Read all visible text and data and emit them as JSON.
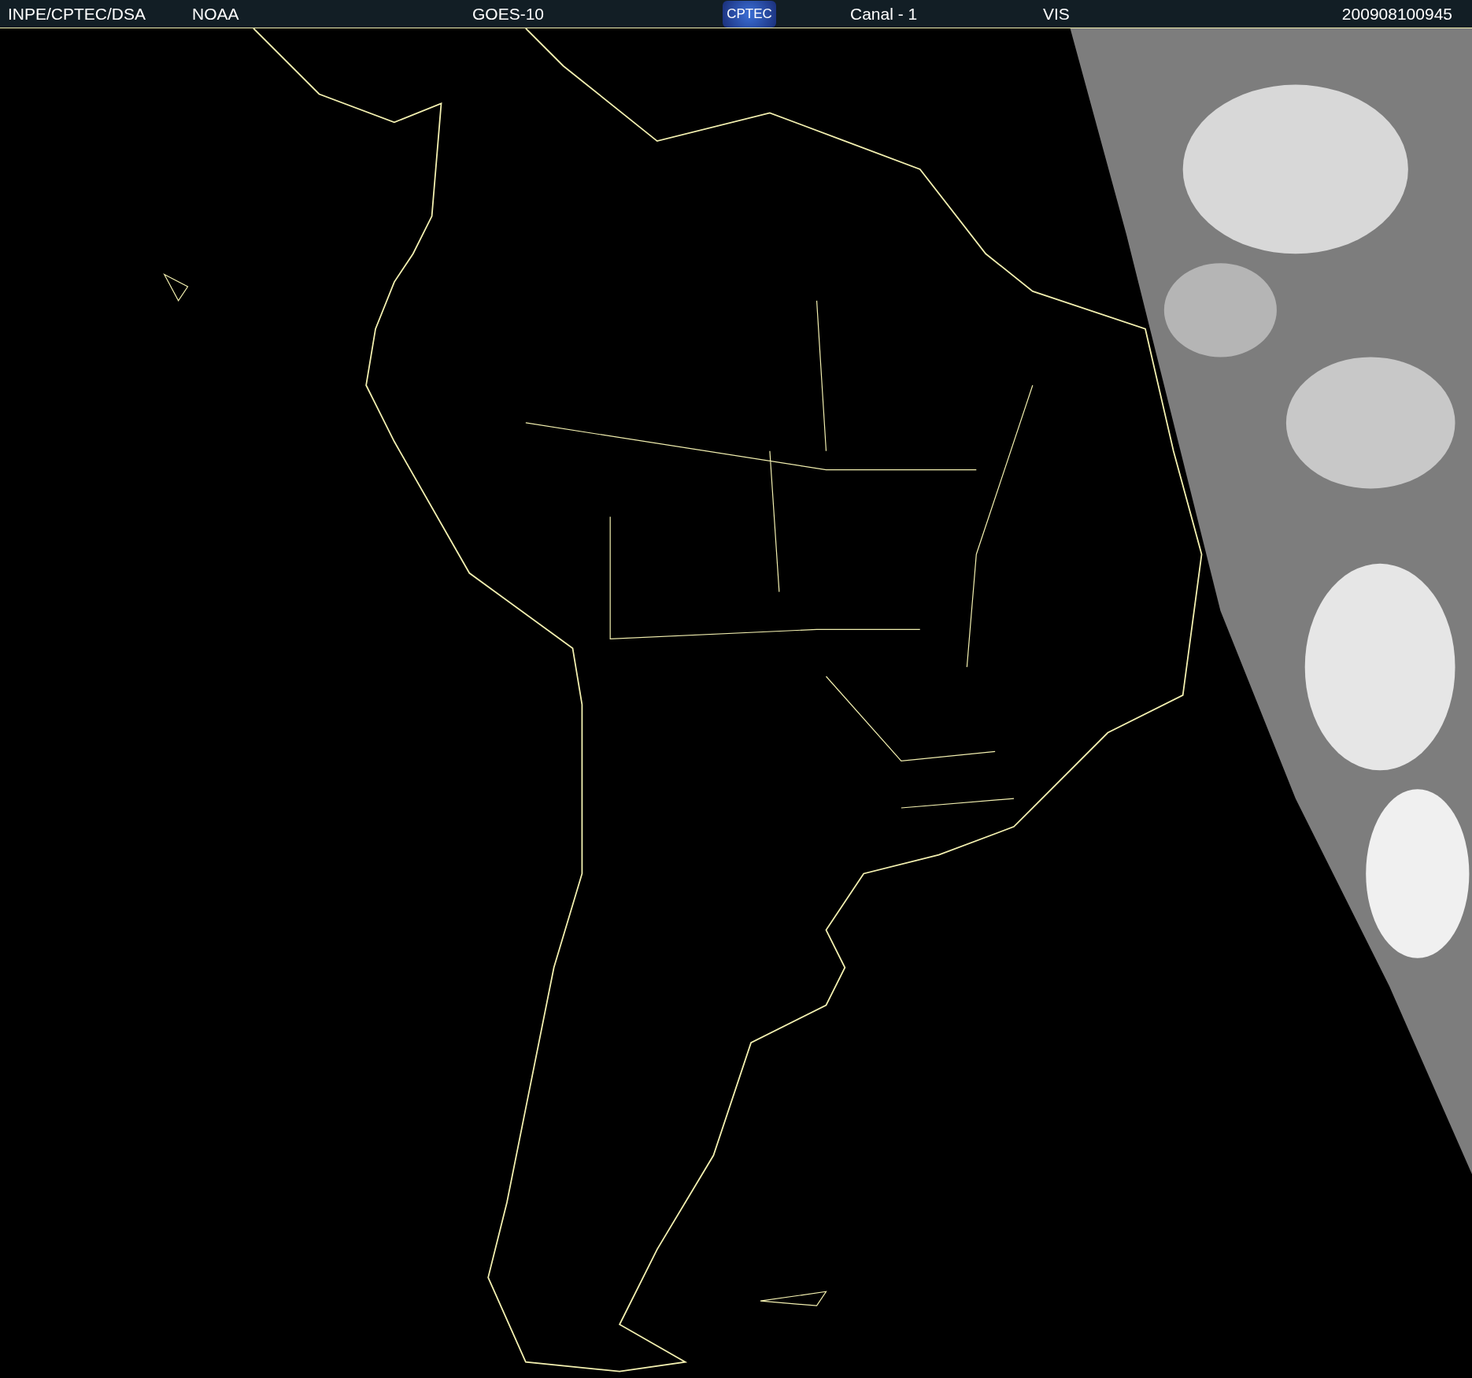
{
  "header": {
    "source": "INPE/CPTEC/DSA",
    "agency": "NOAA",
    "satellite": "GOES-10",
    "logo_text": "CPTEC",
    "channel": "Canal - 1",
    "band": "VIS",
    "timestamp": "200908100945"
  }
}
